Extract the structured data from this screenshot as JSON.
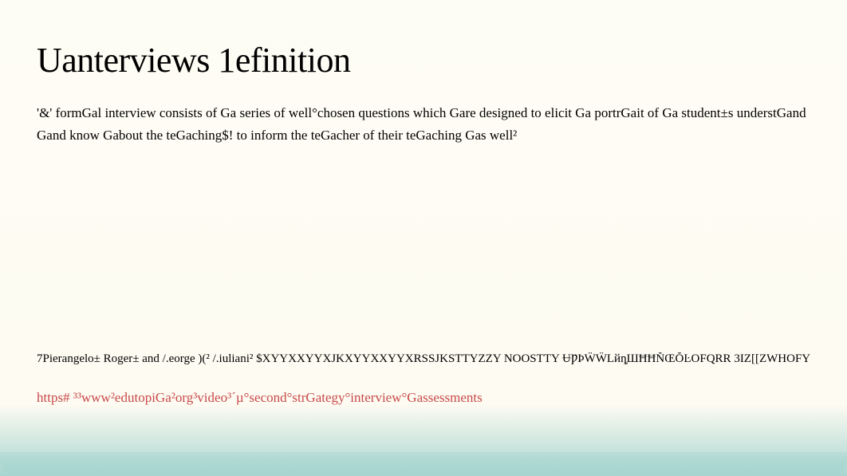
{
  "title": "Uanterviews 1efinition",
  "description_line1": "'&' formGal interview consists of Ga series of well°chosen questions which Gare designed to elicit Ga portrGait of Ga student±s understGand",
  "description_line2": "Gand know Gabout the teGaching$! to inform the teGacher of their teGaching Gas well²",
  "citation": "7Pierangelo± Roger± and /.eorge )(² /.iuliani²    $XYYXXYYXJKXYYXXYYXRSSJKSTTYZZY NOOSTTY ɄǷÞẄẄLйȵШĦĦŇŒŎĿOFQRR 3IZ[[ZWHOFYZZ",
  "link_text": "https# ³³www²edutopiGa²org³video³´µ°second°strGategy°interview°Gassessments"
}
